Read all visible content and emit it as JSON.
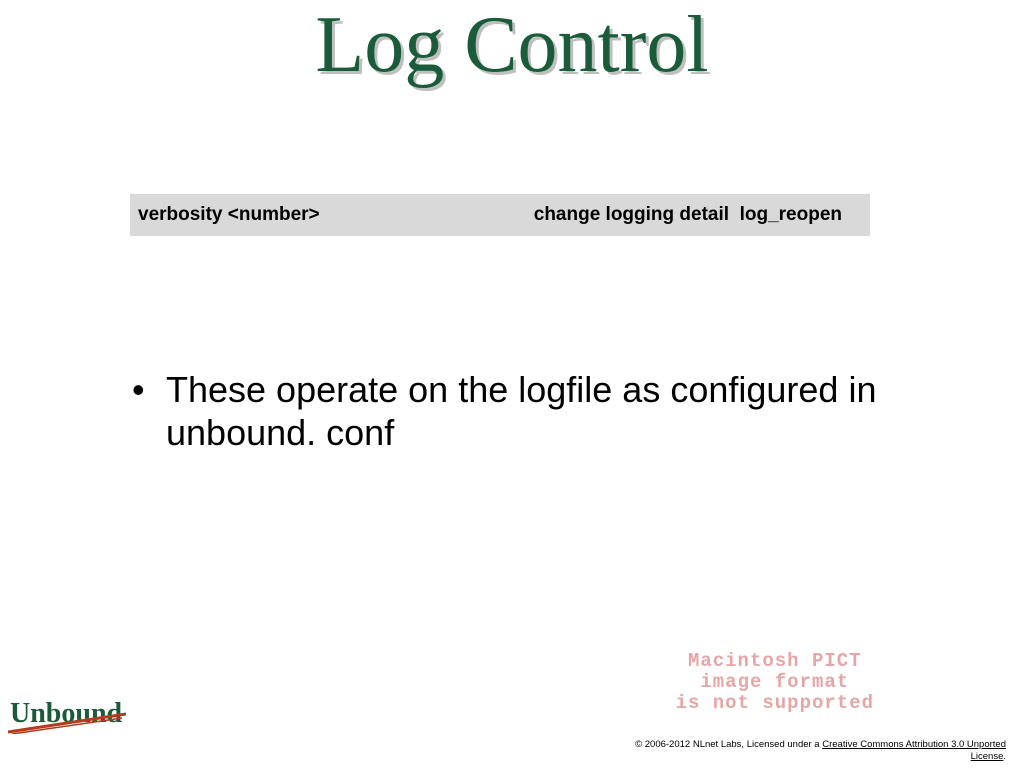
{
  "title": "Log Control",
  "command": {
    "left": "verbosity <number>",
    "right": "change logging detail  log_reopen"
  },
  "bullet_text": "These operate on the logfile as configured in unbound. conf",
  "logo_text": "Unbound",
  "pict_warning": "Macintosh PICT\nimage format\nis not supported",
  "license": {
    "prefix": "© 2006-2012 NLnet Labs, Licensed under a ",
    "link_text": "Creative Commons Attribution 3.0 Unported License",
    "suffix": "."
  }
}
